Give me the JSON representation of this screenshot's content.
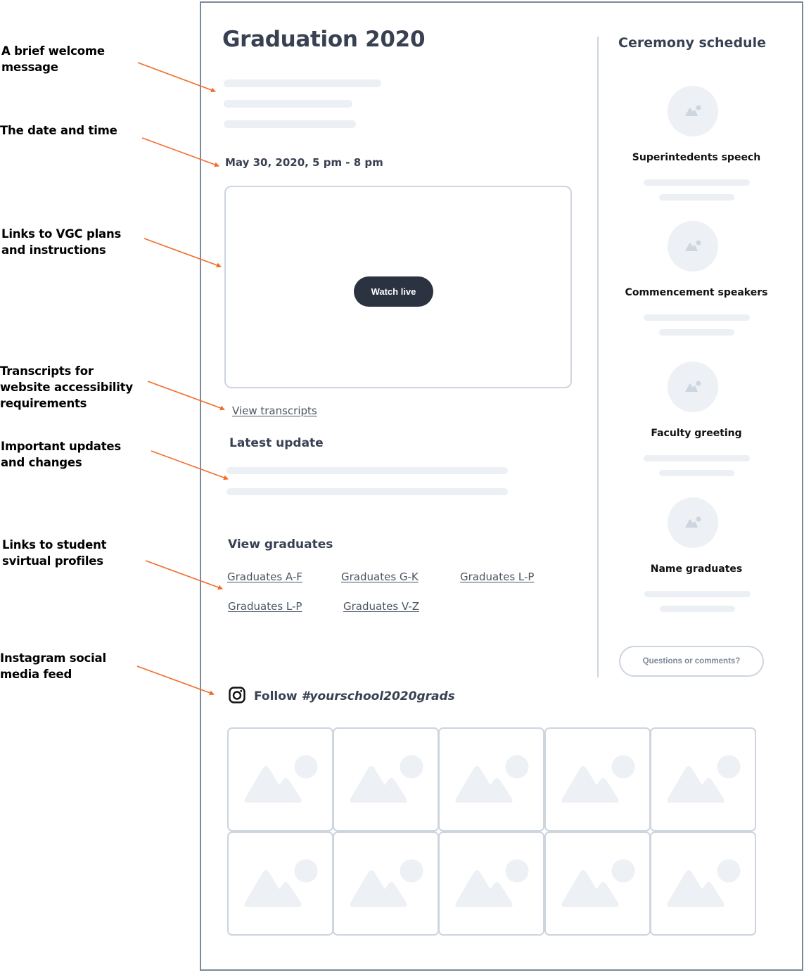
{
  "annotations": [
    {
      "label": "A brief welcome message",
      "lines": [
        "A brief welcome",
        "message"
      ]
    },
    {
      "label": "The date and time",
      "lines": [
        "The date and time"
      ]
    },
    {
      "label": "Links to VGC plans and instructions",
      "lines": [
        "Links to VGC plans",
        "and instructions"
      ]
    },
    {
      "label": "Transcripts for website accessibility requirements",
      "lines": [
        "Transcripts for",
        "website accessibility",
        "requirements"
      ]
    },
    {
      "label": "Important updates and changes",
      "lines": [
        "Important updates",
        "and changes"
      ]
    },
    {
      "label": "Links to student svirtual profiles",
      "lines": [
        "Links to student",
        "svirtual profiles"
      ]
    },
    {
      "label": "Instagram social media feed",
      "lines": [
        "Instagram social",
        "media feed"
      ]
    }
  ],
  "colors": {
    "annotation_arrow": "#f26b2a",
    "frame_border": "#7b8a9b",
    "heading_text": "#374151",
    "placeholder": "#edf0f4",
    "outline": "#cdd5df",
    "button_dark": "#2a333f"
  },
  "page": {
    "title": "Graduation 2020",
    "date_time": "May 30, 2020, 5 pm - 8 pm",
    "watch_live_label": "Watch live",
    "view_transcripts_label": "View transcripts",
    "latest_update_heading": "Latest update",
    "view_graduates_heading": "View graduates",
    "graduate_links": [
      "Graduates A-F",
      "Graduates G-K",
      "Graduates L-P",
      "Graduates L-P",
      "Graduates V-Z"
    ],
    "instagram": {
      "icon": "instagram-icon",
      "follow_prefix": "Follow",
      "hashtag": "#yourschool2020grads",
      "photo_count": 10
    }
  },
  "schedule": {
    "title": "Ceremony schedule",
    "items": [
      {
        "label": "Superintedents speech",
        "icon": "image-placeholder-icon"
      },
      {
        "label": "Commencement speakers",
        "icon": "image-placeholder-icon"
      },
      {
        "label": "Faculty greeting",
        "icon": "image-placeholder-icon"
      },
      {
        "label": "Name graduates",
        "icon": "image-placeholder-icon"
      }
    ],
    "questions_button_label": "Questions or comments?"
  }
}
